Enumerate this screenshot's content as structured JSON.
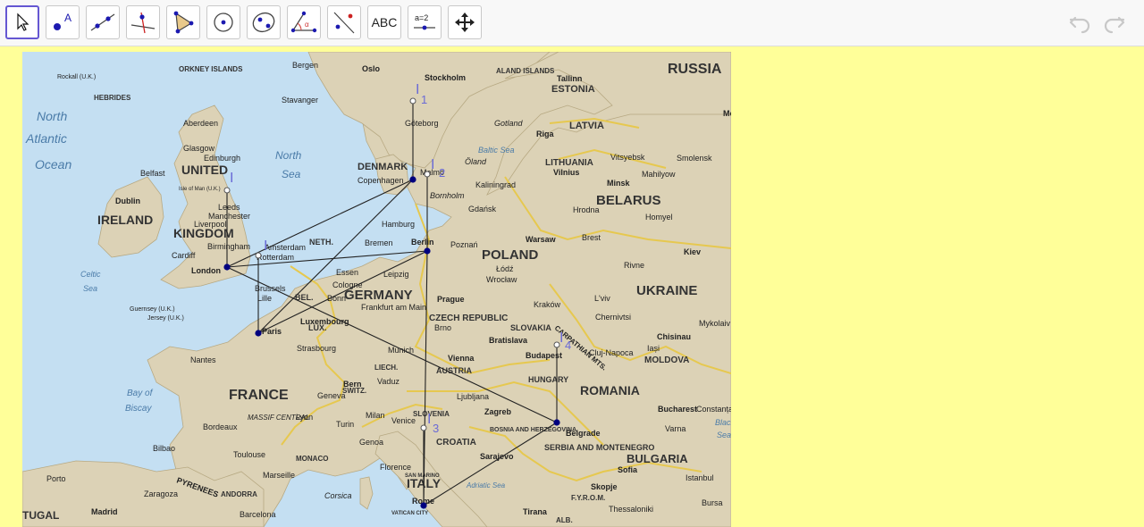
{
  "toolbar": {
    "tools": [
      {
        "name": "move-tool",
        "label": ""
      },
      {
        "name": "point-tool",
        "label": "A"
      },
      {
        "name": "line-tool",
        "label": ""
      },
      {
        "name": "perpendicular-tool",
        "label": ""
      },
      {
        "name": "polygon-tool",
        "label": ""
      },
      {
        "name": "circle-center-tool",
        "label": ""
      },
      {
        "name": "ellipse-tool",
        "label": ""
      },
      {
        "name": "angle-tool",
        "label": "α"
      },
      {
        "name": "reflect-tool",
        "label": ""
      },
      {
        "name": "text-tool",
        "label": "ABC"
      },
      {
        "name": "slider-tool",
        "label": "a=2"
      },
      {
        "name": "move-graphics-tool",
        "label": ""
      }
    ],
    "undo_label": "undo",
    "redo_label": "redo"
  },
  "map": {
    "countries": [
      "RUSSIA",
      "UNITED",
      "KINGDOM",
      "IRELAND",
      "DENMARK",
      "NETH.",
      "BEL.",
      "LUX.",
      "GERMANY",
      "FRANCE",
      "POLAND",
      "BELARUS",
      "LITHUANIA",
      "LATVIA",
      "ESTONIA",
      "UKRAINE",
      "MOLDOVA",
      "ROMANIA",
      "BULGARIA",
      "HUNGARY",
      "SLOVAKIA",
      "CZECH REPUBLIC",
      "AUSTRIA",
      "SLOVENIA",
      "CROATIA",
      "BOSNIA AND HERZEGOVINA",
      "SERBIA AND MONTENEGRO",
      "ITALY",
      "LIECH.",
      "SWITZ.",
      "MONACO",
      "ANDORRA",
      "SAN MARINO",
      "VATICAN CITY",
      "F.Y.R.O.M.",
      "ALB.",
      "ALAND ISLANDS",
      "ORKNEY ISLANDS",
      "HEBRIDES",
      "RUSSIA",
      "TUGAL"
    ],
    "seas": [
      "North",
      "Atlantic",
      "Ocean",
      "North",
      "Sea",
      "Baltic Sea",
      "Celtic",
      "Sea",
      "Bay of",
      "Biscay",
      "Adriatic Sea",
      "Black",
      "Sea"
    ],
    "cities": [
      "Oslo",
      "Stockholm",
      "Tallinn",
      "Bergen",
      "Stavanger",
      "Göteborg",
      "Gotland",
      "Riga",
      "Moscow",
      "Aberdeen",
      "Glasgow",
      "Edinburgh",
      "Belfast",
      "Dublin",
      "Leeds",
      "Manchester",
      "Liverpool",
      "Birmingham",
      "Cardiff",
      "London",
      "Copenhagen",
      "Malmö",
      "Bornholm",
      "Öland",
      "Kaliningrad",
      "Vilnius",
      "Minsk",
      "Vitsyebsk",
      "Mahilyow",
      "Smolensk",
      "Hrodna",
      "Homyel",
      "Gdańsk",
      "Hamburg",
      "Bremen",
      "Berlin",
      "Poznań",
      "Warsaw",
      "Brest",
      "Amsterdam",
      "Rotterdam",
      "Essen",
      "Cologne",
      "Leipzig",
      "Łódź",
      "Wrocław",
      "Kiev",
      "Rivne",
      "Brussels",
      "Lille",
      "Bonn",
      "Frankfurt am Main",
      "Prague",
      "Kraków",
      "L'viv",
      "Chernivtsi",
      "Paris",
      "Luxembourg",
      "Strasbourg",
      "Munich",
      "Brno",
      "Bratislava",
      "Vienna",
      "Budapest",
      "Chisinau",
      "Mykolaiv",
      "Iași",
      "Cluj-Napoca",
      "Nantes",
      "Bern",
      "Geneva",
      "Vaduz",
      "Ljubljana",
      "Zagreb",
      "Bucharest",
      "Constanța",
      "Lyon",
      "Milan",
      "Turin",
      "Venice",
      "Genoa",
      "Marseille",
      "Toulouse",
      "Bordeaux",
      "Bilbao",
      "Florence",
      "Sarajevo",
      "Belgrade",
      "Sofia",
      "Varna",
      "Skopje",
      "Istanbul",
      "Bursa",
      "Porto",
      "Zaragoza",
      "Madrid",
      "Barcelona",
      "Corsica",
      "Rome",
      "Tirana",
      "Thessaloniki",
      "Rockall (U.K.)",
      "Guernsey (U.K.)",
      "Jersey (U.K.)",
      "Isle of Man (U.K.)",
      "PYRENEES",
      "MASSIF CENTRAL",
      "CARPATHIAN MTS."
    ],
    "point_labels": [
      "I",
      "I",
      "I",
      "I",
      "1",
      "I",
      "2",
      "I",
      "3",
      "I",
      "4"
    ]
  },
  "colors": {
    "accent": "#6557d2",
    "point": "#00007f",
    "label": "#6a6ad6",
    "sea": "#c4dff2",
    "land": "#dcd2b6",
    "background": "#ffff99"
  }
}
